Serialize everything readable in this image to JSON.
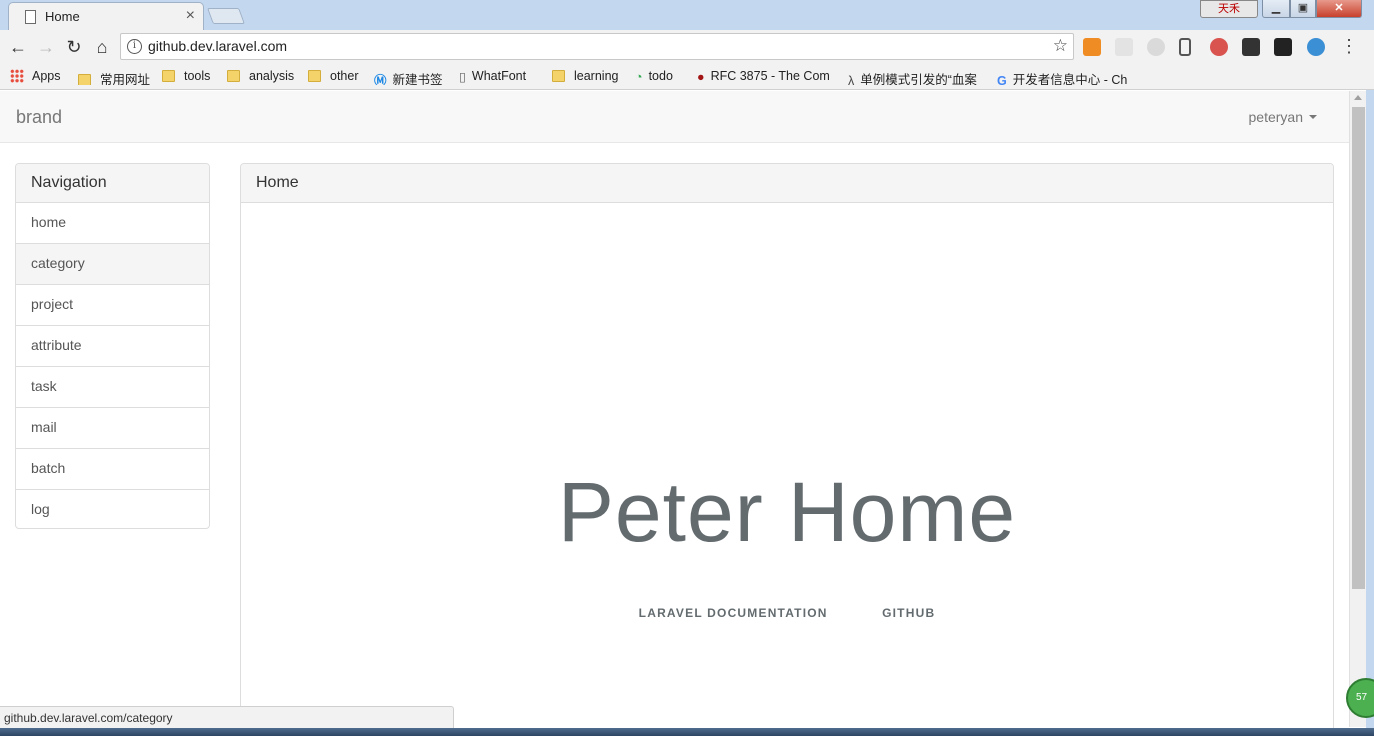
{
  "browser": {
    "tab_title": "Home",
    "tab_close": "×",
    "ime_label": "天禾",
    "url": "github.dev.laravel.com",
    "status_url": "github.dev.laravel.com/category",
    "badge_text": "57"
  },
  "bookmarks": [
    {
      "label": "Apps",
      "icon": "apps-grid-icon"
    },
    {
      "label": "常用网址",
      "icon": "folder-icon"
    },
    {
      "label": "tools",
      "icon": "folder-icon"
    },
    {
      "label": "analysis",
      "icon": "folder-icon"
    },
    {
      "label": "other",
      "icon": "folder-icon"
    },
    {
      "label": "新建书签",
      "icon": "m-logo-icon"
    },
    {
      "label": "WhatFont",
      "icon": "page-icon"
    },
    {
      "label": "learning",
      "icon": "folder-icon"
    },
    {
      "label": "todo",
      "icon": "todo-icon"
    },
    {
      "label": "RFC 3875 - The Com",
      "icon": "rfc-icon"
    },
    {
      "label": "单例模式引发的“血案",
      "icon": "lambda-icon"
    },
    {
      "label": "开发者信息中心 - Ch",
      "icon": "google-icon"
    }
  ],
  "navbar": {
    "brand": "brand",
    "user": "peteryan"
  },
  "sidebar": {
    "heading": "Navigation",
    "items": [
      "home",
      "category",
      "project",
      "attribute",
      "task",
      "mail",
      "batch",
      "log"
    ],
    "active_index": 1
  },
  "main": {
    "heading": "Home",
    "title": "Peter Home",
    "links": [
      "LARAVEL DOCUMENTATION",
      "GITHUB"
    ]
  },
  "colors": {
    "title": "#636b6f",
    "panel_heading_bg": "#f5f5f5",
    "navbar_bg": "#f8f8f8",
    "chrome_frame": "#c3d7ee"
  }
}
